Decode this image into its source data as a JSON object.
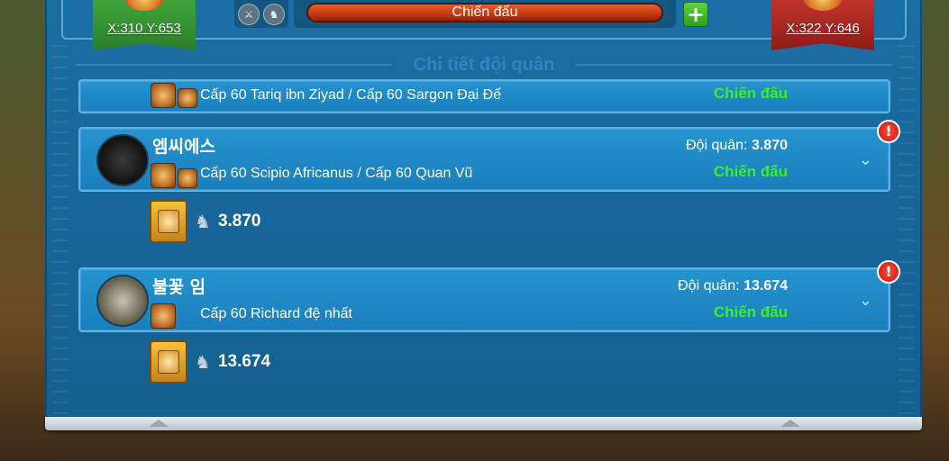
{
  "header": {
    "left_coords": "X:310 Y:653",
    "right_coords": "X:322 Y:646",
    "fight_label": "Chiến đấu",
    "plus_label": "+"
  },
  "section_title": "Chi tiết đội quân",
  "rows": [
    {
      "commanders": "Cấp 60 Tariq ibn Ziyad / Cấp 60 Sargon Đại Đế",
      "status": "Chiến đấu"
    },
    {
      "name": "엠씨에스",
      "troops_label": "Đội quân:",
      "troops_value": "3.870",
      "commanders": "Cấp 60 Scipio Africanus / Cấp 60 Quan Vũ",
      "status": "Chiến đấu",
      "alert": "!",
      "detail_count": "3.870"
    },
    {
      "name": "불꽃 임",
      "troops_label": "Đội quân:",
      "troops_value": "13.674",
      "commanders": "Cấp 60 Richard đệ nhất",
      "status": "Chiến đấu",
      "alert": "!",
      "detail_count": "13.674"
    }
  ],
  "colors": {
    "panel": "#1b6ea3",
    "row": "#2593cf",
    "status_green": "#3cf024",
    "alert_red": "#c71612"
  }
}
